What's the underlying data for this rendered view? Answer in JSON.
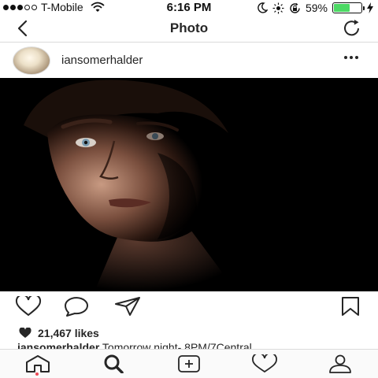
{
  "status_bar": {
    "carrier": "T-Mobile",
    "time": "6:16 PM",
    "battery_percent": "59%",
    "battery_level": 0.59,
    "signal_bars_filled": 3,
    "signal_bars_total": 5,
    "icons": [
      "wifi-icon",
      "moon-icon",
      "brightness-icon",
      "rotation-lock-icon",
      "battery-icon",
      "charging-icon"
    ]
  },
  "nav": {
    "title": "Photo",
    "back_icon": "chevron-left-icon",
    "refresh_icon": "refresh-icon"
  },
  "post": {
    "username": "iansomerhalder",
    "more_icon": "more-horizontal-icon",
    "likes": "21,467 likes",
    "caption_user": "iansomerhalder",
    "caption_text": "Tomorrow night- 8PM/7Central"
  },
  "actions": [
    "like-icon",
    "comment-icon",
    "share-icon",
    "bookmark-icon"
  ],
  "tab_bar": [
    "home-icon",
    "search-icon",
    "add-icon",
    "activity-icon",
    "profile-icon"
  ],
  "colors": {
    "text": "#262626",
    "divider": "#dbdbdb",
    "battery": "#4cd964",
    "notification_dot": "#ed4956",
    "tab_bar_bg": "#fafafa"
  }
}
